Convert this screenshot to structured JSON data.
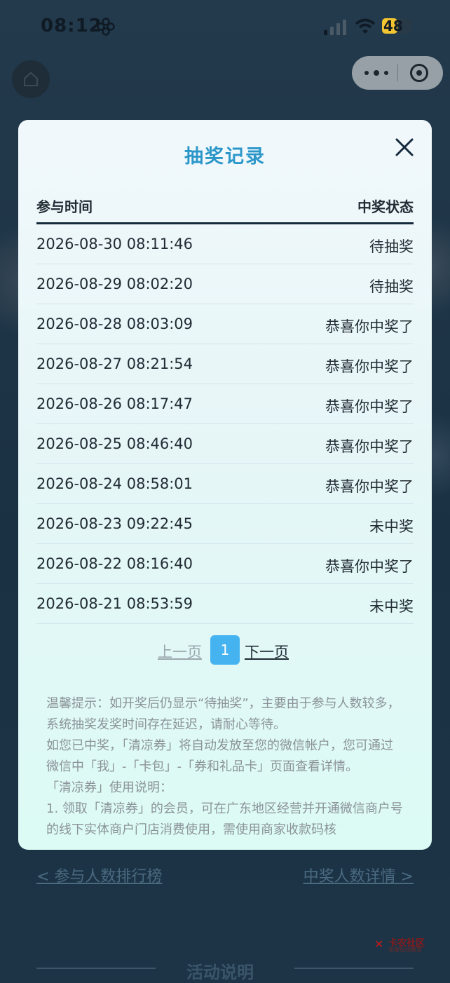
{
  "status_bar": {
    "time": "08:12",
    "battery": "48"
  },
  "modal": {
    "title": "抽奖记录",
    "col_time": "参与时间",
    "col_status": "中奖状态",
    "rows": [
      {
        "time": "2026-08-30 08:11:46",
        "status": "待抽奖"
      },
      {
        "time": "2026-08-29 08:02:20",
        "status": "待抽奖"
      },
      {
        "time": "2026-08-28 08:03:09",
        "status": "恭喜你中奖了"
      },
      {
        "time": "2026-08-27 08:21:54",
        "status": "恭喜你中奖了"
      },
      {
        "time": "2026-08-26 08:17:47",
        "status": "恭喜你中奖了"
      },
      {
        "time": "2026-08-25 08:46:40",
        "status": "恭喜你中奖了"
      },
      {
        "time": "2026-08-24 08:58:01",
        "status": "恭喜你中奖了"
      },
      {
        "time": "2026-08-23 09:22:45",
        "status": "未中奖"
      },
      {
        "time": "2026-08-22 08:16:40",
        "status": "恭喜你中奖了"
      },
      {
        "time": "2026-08-21 08:53:59",
        "status": "未中奖"
      }
    ],
    "pagination": {
      "prev": "上一页",
      "current": "1",
      "next": "下一页"
    },
    "notes": [
      "温馨提示：如开奖后仍显示“待抽奖”，主要由于参与人数较多，系统抽奖发奖时间存在延迟，请耐心等待。",
      "如您已中奖，「清凉券」将自动发放至您的微信帐户，您可通过微信中「我」-「卡包」-「券和礼品卡」页面查看详情。",
      "「清凉券」使用说明：",
      "1. 领取「清凉券」的会员，可在广东地区经营并开通微信商户号的线下实体商户门店消费使用，需使用商家收款码核"
    ]
  },
  "background": {
    "link_left": "< 参与人数排行榜",
    "link_right": "中奖人数详情 >",
    "section_title": "活动说明",
    "watermark": "卡农社区",
    "watermark_sub": "金融在线教育"
  },
  "colors": {
    "accent": "#2b97c9",
    "page_button": "#45b3f0",
    "rule": "#152a3c"
  }
}
